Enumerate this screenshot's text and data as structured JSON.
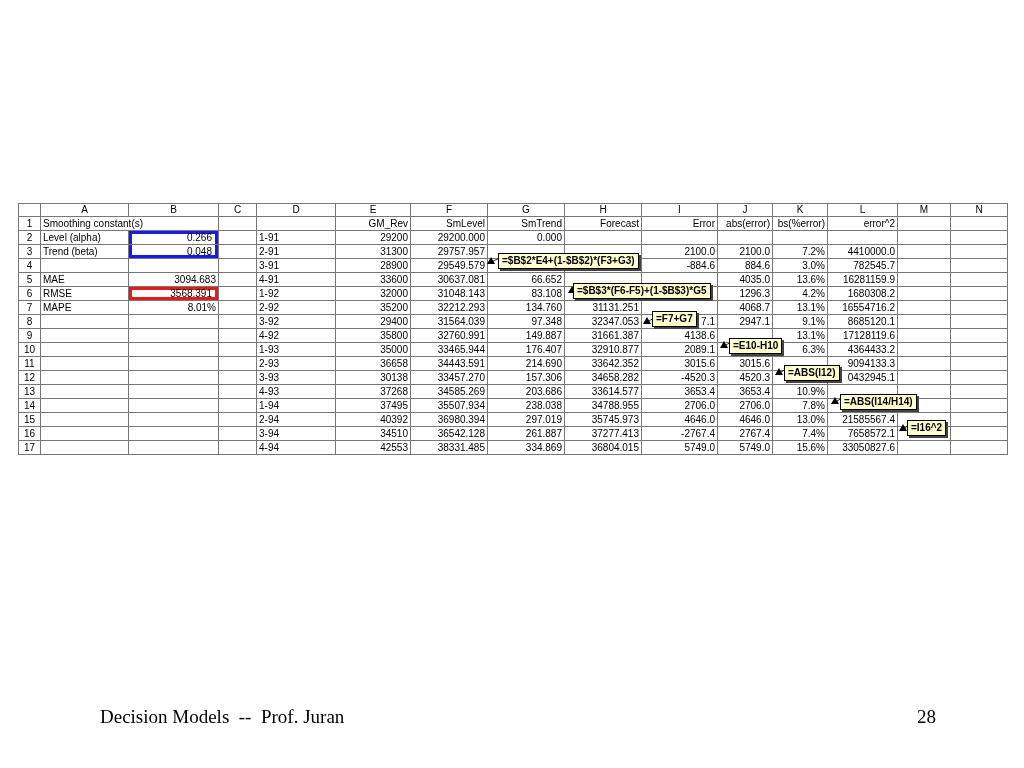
{
  "spreadsheet": {
    "columns": [
      "A",
      "B",
      "C",
      "D",
      "E",
      "F",
      "G",
      "H",
      "I",
      "J",
      "K",
      "L",
      "M",
      "N"
    ],
    "rows": [
      {
        "number": "1",
        "cells": [
          {
            "text": "Smoothing constant(s)",
            "colspan": 2
          },
          null,
          null,
          "GM_Rev",
          "SmLevel",
          "SmTrend",
          "Forecast",
          "Error",
          "abs(error)",
          "bs(%error)",
          "error^2",
          null,
          null
        ]
      },
      {
        "number": "2",
        "cells": [
          "Level (alpha)",
          {
            "text": "0.266",
            "color": "#1a1ae6"
          },
          null,
          "1-91",
          "29200",
          "29200.000",
          "0.000",
          null,
          null,
          null,
          null,
          null,
          null,
          null
        ]
      },
      {
        "number": "3",
        "cells": [
          "Trend (beta)",
          {
            "text": "0.048",
            "color": "#1a1ae6"
          },
          null,
          "2-91",
          "31300",
          "29757.957",
          null,
          null,
          "2100.0",
          "2100.0",
          "7.2%",
          "4410000.0",
          null,
          null
        ]
      },
      {
        "number": "4",
        "cells": [
          null,
          null,
          null,
          "3-91",
          "28900",
          "29549.579",
          null,
          null,
          "-884.6",
          "884.6",
          "3.0%",
          "782545.7",
          null,
          null
        ]
      },
      {
        "number": "5",
        "cells": [
          "MAE",
          "3094.683",
          null,
          "4-91",
          "33600",
          "30637.081",
          "66.652",
          null,
          null,
          "4035.0",
          "13.6%",
          "16281159.9",
          null,
          null
        ]
      },
      {
        "number": "6",
        "cells": [
          "RMSE",
          {
            "text": "3568.391",
            "color": "#e61a1a"
          },
          null,
          "1-92",
          "32000",
          "31048.143",
          "83.108",
          null,
          null,
          "1296.3",
          "4.2%",
          "1680308.2",
          null,
          null
        ]
      },
      {
        "number": "7",
        "cells": [
          "MAPE",
          "8.01%",
          null,
          "2-92",
          "35200",
          "32212.293",
          "134.760",
          "31131.251",
          null,
          "4068.7",
          "13.1%",
          "16554716.2",
          null,
          null
        ]
      },
      {
        "number": "8",
        "cells": [
          null,
          null,
          null,
          "3-92",
          "29400",
          "31564.039",
          "97.348",
          "32347.053",
          "7.1",
          "2947.1",
          "9.1%",
          "8685120.1",
          null,
          null
        ]
      },
      {
        "number": "9",
        "cells": [
          null,
          null,
          null,
          "4-92",
          "35800",
          "32760.991",
          "149.887",
          "31661.387",
          "4138.6",
          null,
          "13.1%",
          "17128119.6",
          null,
          null
        ]
      },
      {
        "number": "10",
        "cells": [
          null,
          null,
          null,
          "1-93",
          "35000",
          "33465.944",
          "176.407",
          "32910.877",
          "2089.1",
          null,
          "6.3%",
          "4364433.2",
          null,
          null
        ]
      },
      {
        "number": "11",
        "cells": [
          null,
          null,
          null,
          "2-93",
          "36658",
          "34443.591",
          "214.690",
          "33642.352",
          "3015.6",
          "3015.6",
          null,
          "9094133.3",
          null,
          null
        ]
      },
      {
        "number": "12",
        "cells": [
          null,
          null,
          null,
          "3-93",
          "30138",
          "33457.270",
          "157.306",
          "34658.282",
          "-4520.3",
          "4520.3",
          null,
          "0432945.1",
          null,
          null
        ]
      },
      {
        "number": "13",
        "cells": [
          null,
          null,
          null,
          "4-93",
          "37268",
          "34585.269",
          "203.686",
          "33614.577",
          "3653.4",
          "3653.4",
          "10.9%",
          null,
          null,
          null
        ]
      },
      {
        "number": "14",
        "cells": [
          null,
          null,
          null,
          "1-94",
          "37495",
          "35507.934",
          "238.038",
          "34788.955",
          "2706.0",
          "2706.0",
          "7.8%",
          null,
          null,
          null
        ]
      },
      {
        "number": "15",
        "cells": [
          null,
          null,
          null,
          "2-94",
          "40392",
          "36980.394",
          "297.019",
          "35745.973",
          "4646.0",
          "4646.0",
          "13.0%",
          "21585567.4",
          null,
          null
        ]
      },
      {
        "number": "16",
        "cells": [
          null,
          null,
          null,
          "3-94",
          "34510",
          "36542.128",
          "261.887",
          "37277.413",
          "-2767.4",
          "2767.4",
          "7.4%",
          "7658572.1",
          null,
          null
        ]
      },
      {
        "number": "17",
        "cells": [
          null,
          null,
          null,
          "4-94",
          "42553",
          "38331.485",
          "334.869",
          "36804.015",
          "5749.0",
          "5749.0",
          "15.6%",
          "33050827.6",
          null,
          null
        ]
      }
    ],
    "notes": [
      {
        "text": "=$B$2*E4+(1-$B$2)*(F3+G3)"
      },
      {
        "text": "=$B$3*(F6-F5)+(1-$B$3)*G5"
      },
      {
        "text": "=F7+G7"
      },
      {
        "text": "=E10-H10"
      },
      {
        "text": "=ABS(I12)"
      },
      {
        "text": "=ABS(I14/H14)"
      },
      {
        "text": "=I16^2"
      }
    ]
  },
  "footer": {
    "title": "Decision Models  --  Prof. Juran",
    "page": "28"
  }
}
